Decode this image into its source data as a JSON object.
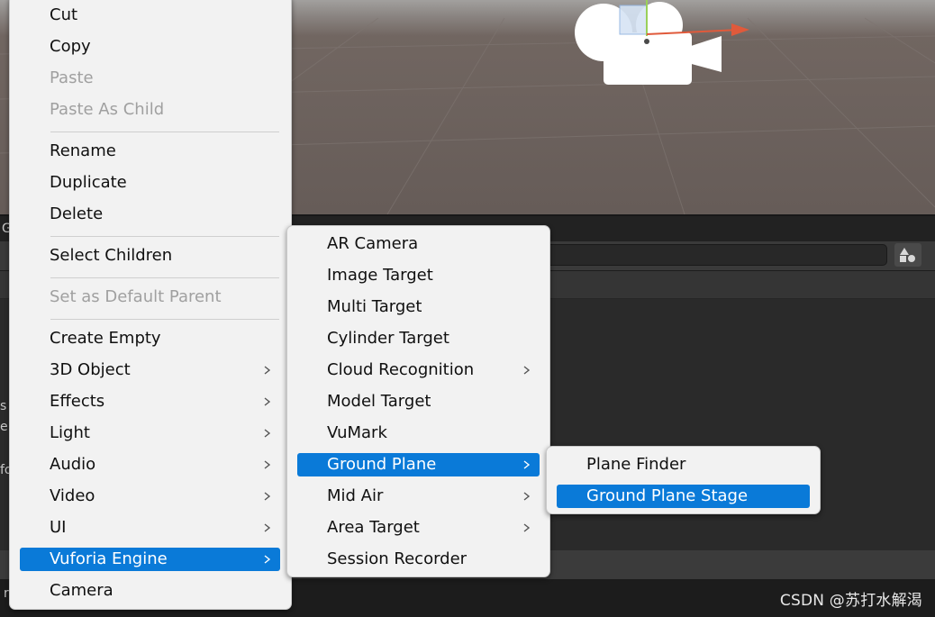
{
  "scene": {
    "colors": {
      "sky": "#a2a09e",
      "ground": "#665c58",
      "gizmo_x_axis": "#e05a3b"
    }
  },
  "panel": {
    "tab_letter": "G",
    "side_letters": [
      "s",
      "e",
      "fo"
    ],
    "bottom_letter": "r"
  },
  "context_menu": {
    "items": [
      {
        "label": "Cut",
        "state": "normal"
      },
      {
        "label": "Copy",
        "state": "normal"
      },
      {
        "label": "Paste",
        "state": "disabled"
      },
      {
        "label": "Paste As Child",
        "state": "disabled"
      },
      {
        "label": "Rename",
        "state": "normal"
      },
      {
        "label": "Duplicate",
        "state": "normal"
      },
      {
        "label": "Delete",
        "state": "normal"
      },
      {
        "label": "Select Children",
        "state": "normal"
      },
      {
        "label": "Set as Default Parent",
        "state": "disabled"
      },
      {
        "label": "Create Empty",
        "state": "normal"
      },
      {
        "label": "3D Object",
        "state": "normal",
        "submenu": true
      },
      {
        "label": "Effects",
        "state": "normal",
        "submenu": true
      },
      {
        "label": "Light",
        "state": "normal",
        "submenu": true
      },
      {
        "label": "Audio",
        "state": "normal",
        "submenu": true
      },
      {
        "label": "Video",
        "state": "normal",
        "submenu": true
      },
      {
        "label": "UI",
        "state": "normal",
        "submenu": true
      },
      {
        "label": "Vuforia Engine",
        "state": "selected",
        "submenu": true
      },
      {
        "label": "Camera",
        "state": "normal"
      }
    ]
  },
  "vuforia_menu": {
    "items": [
      {
        "label": "AR Camera",
        "state": "normal"
      },
      {
        "label": "Image Target",
        "state": "normal"
      },
      {
        "label": "Multi Target",
        "state": "normal"
      },
      {
        "label": "Cylinder Target",
        "state": "normal"
      },
      {
        "label": "Cloud Recognition",
        "state": "normal",
        "submenu": true
      },
      {
        "label": "Model Target",
        "state": "normal"
      },
      {
        "label": "VuMark",
        "state": "normal"
      },
      {
        "label": "Ground Plane",
        "state": "selected",
        "submenu": true
      },
      {
        "label": "Mid Air",
        "state": "normal",
        "submenu": true
      },
      {
        "label": "Area Target",
        "state": "normal",
        "submenu": true
      },
      {
        "label": "Session Recorder",
        "state": "normal"
      }
    ]
  },
  "ground_plane_menu": {
    "items": [
      {
        "label": "Plane Finder",
        "state": "normal"
      },
      {
        "label": "Ground Plane Stage",
        "state": "selected"
      }
    ]
  },
  "watermark": "CSDN @苏打水解渴",
  "colors": {
    "menu_bg": "#f2f2f2",
    "selection": "#0a7ad8",
    "disabled_text": "#a0a0a0"
  }
}
